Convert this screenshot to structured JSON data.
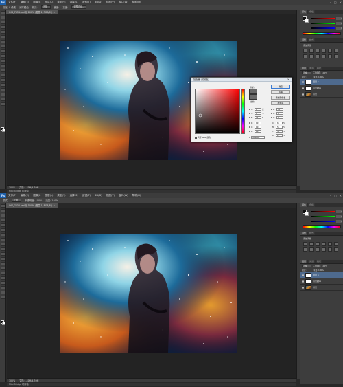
{
  "colors": {
    "workspace_bg": "#282828",
    "panel_bg": "#3d3d3d",
    "menubar_bg": "#3c3c3c",
    "accent_logo": "#1d5fa8",
    "layer_selected": "#4e6a8e"
  },
  "app": {
    "logo": "Ps",
    "menu": [
      "文件(F)",
      "编辑(E)",
      "图像(I)",
      "图层(L)",
      "类型(Y)",
      "选择(S)",
      "滤镜(T)",
      "3D(D)",
      "视图(V)",
      "窗口(W)",
      "帮助(H)"
    ],
    "window_controls": [
      "–",
      "□",
      "×"
    ]
  },
  "top": {
    "options": {
      "labels": [
        "羽化: 0 像素",
        "消除锯齿",
        "样式:",
        "正常",
        "宽度:",
        "高度:",
        "调整边缘..."
      ]
    },
    "doc_tab": "IMG_7434.psd @ 100% (图层 1, RGB/8*) ×",
    "status": {
      "zoom": "100%",
      "doc_info": "文档:1.41M/4.39M"
    },
    "timeline_label": "Mini Bridge  时间轴"
  },
  "bottom": {
    "options": {
      "labels": [
        "模式:",
        "正常",
        "不透明度: 100%",
        "流量: 100%"
      ]
    },
    "doc_tab": "IMG_7434.psd @ 100% (图层 1, RGB/8*) ×",
    "status": {
      "zoom": "100%",
      "doc_info": "文档:1.41M/4.39M"
    },
    "timeline_label": "Mini Bridge  时间轴"
  },
  "panels": {
    "color_tabs": [
      "颜色",
      "色板"
    ],
    "color_fg_label": "前景色",
    "sliders": [
      {
        "name": "R",
        "value": "0"
      },
      {
        "name": "G",
        "value": "0"
      },
      {
        "name": "B",
        "value": "0"
      }
    ],
    "adjust_tabs": [
      "调整",
      "样式"
    ],
    "adjust_title": "添加调整",
    "layers_tabs": [
      "图层",
      "通道",
      "路径"
    ],
    "blend_mode": "正常",
    "opacity": "不透明度: 100%",
    "lock_label": "锁定:",
    "fill": "填充: 100%",
    "layers": [
      {
        "name": "图层 1",
        "thumb": "white",
        "selected": true
      },
      {
        "name": "背景副本",
        "thumb": "img",
        "selected": false
      },
      {
        "name": "背景",
        "thumb": "img",
        "selected": false
      }
    ]
  },
  "dialog": {
    "title": "拾色器 (前景色)",
    "new_label": "新的",
    "current_label": "当前",
    "buttons": [
      "确定",
      "取消",
      "添加到色板",
      "颜色库"
    ],
    "fields_left": [
      {
        "label": "H:",
        "value": "0",
        "unit": "度"
      },
      {
        "label": "S:",
        "value": "0",
        "unit": "%"
      },
      {
        "label": "B:",
        "value": "42",
        "unit": "%"
      },
      {
        "label": "R:",
        "value": "107",
        "unit": ""
      },
      {
        "label": "G:",
        "value": "107",
        "unit": ""
      },
      {
        "label": "B:",
        "value": "107",
        "unit": ""
      }
    ],
    "fields_right": [
      {
        "label": "L:",
        "value": "45",
        "unit": ""
      },
      {
        "label": "a:",
        "value": "0",
        "unit": ""
      },
      {
        "label": "b:",
        "value": "0",
        "unit": ""
      },
      {
        "label": "C:",
        "value": "61",
        "unit": "%"
      },
      {
        "label": "M:",
        "value": "53",
        "unit": "%"
      },
      {
        "label": "Y:",
        "value": "50",
        "unit": "%"
      },
      {
        "label": "K:",
        "value": "21",
        "unit": "%"
      }
    ],
    "hex_label": "#",
    "hex_value": "6b6b6b",
    "web_only": "只有 Web 颜色"
  }
}
